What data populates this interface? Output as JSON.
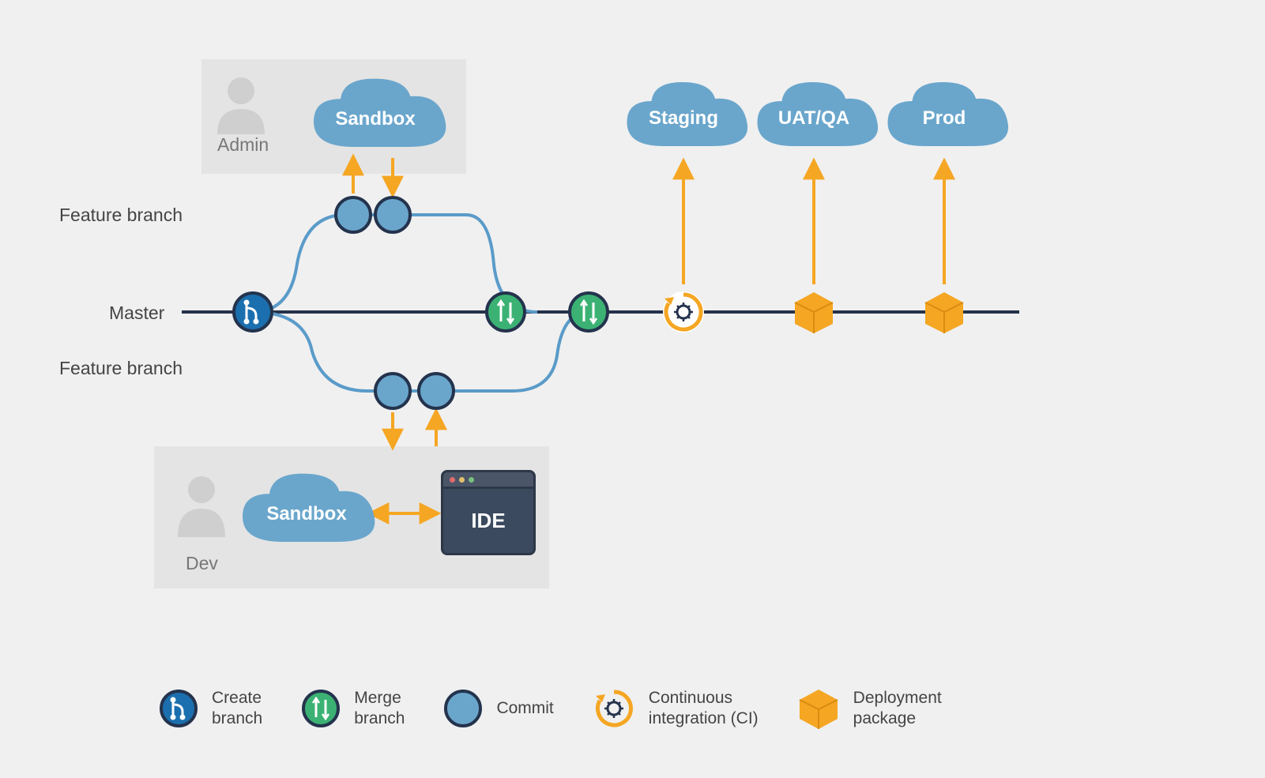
{
  "labels": {
    "feature_branch_top": "Feature branch",
    "master": "Master",
    "feature_branch_bottom": "Feature branch"
  },
  "roles": {
    "admin": "Admin",
    "dev": "Dev"
  },
  "clouds": {
    "admin_sandbox": "Sandbox",
    "dev_sandbox": "Sandbox",
    "staging": "Staging",
    "uat": "UAT/QA",
    "prod": "Prod"
  },
  "ide": {
    "label": "IDE"
  },
  "legend": {
    "create_branch": "Create\nbranch",
    "merge_branch": "Merge\nbranch",
    "commit": "Commit",
    "ci": "Continuous\nintegration (CI)",
    "deployment": "Deployment\npackage"
  }
}
